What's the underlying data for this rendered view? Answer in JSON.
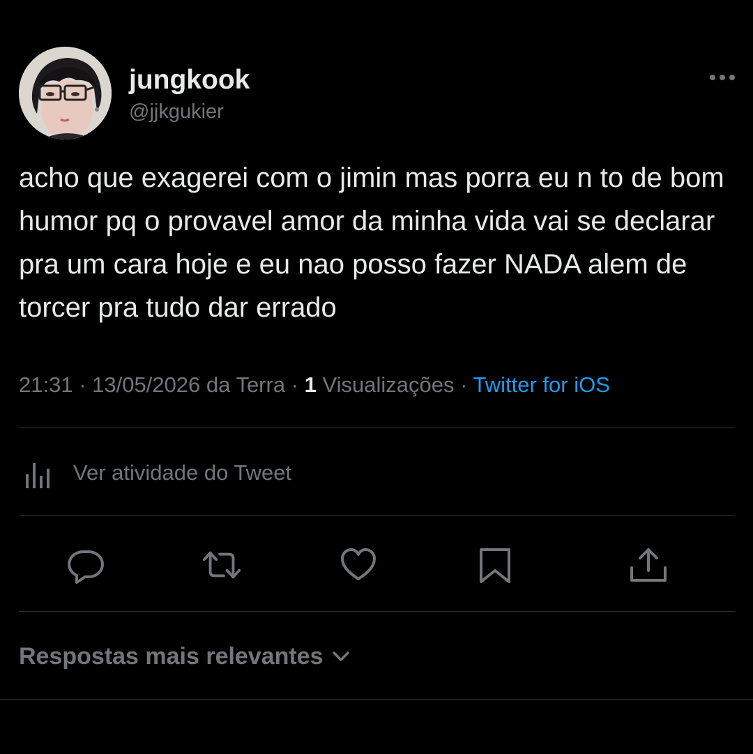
{
  "author": {
    "display_name": "jungkook",
    "handle": "@jjkgukier"
  },
  "tweet": {
    "text": "acho que exagerei com o jimin mas porra eu n to de bom humor pq o provavel amor da minha vida vai se declarar pra um cara hoje e eu nao posso fazer NADA alem de torcer pra tudo dar errado",
    "time": "21:31",
    "date": "13/05/2026 da Terra",
    "views_count": "1",
    "views_label": "Visualizações",
    "source": "Twitter for iOS",
    "separator": " · "
  },
  "activity": {
    "label": "Ver atividade do Tweet",
    "icon": "analytics-icon"
  },
  "actions": [
    {
      "name": "reply",
      "icon": "reply-icon"
    },
    {
      "name": "retweet",
      "icon": "retweet-icon"
    },
    {
      "name": "like",
      "icon": "heart-icon"
    },
    {
      "name": "bookmark",
      "icon": "bookmark-icon"
    },
    {
      "name": "share",
      "icon": "share-icon"
    }
  ],
  "replies": {
    "sort_label": "Respostas mais relevantes",
    "icon": "chevron-down-icon"
  },
  "colors": {
    "background": "#000000",
    "primary_text": "#e7e9ea",
    "secondary_text": "#71767b",
    "link": "#1d9bf0",
    "divider": "#2f3336"
  }
}
